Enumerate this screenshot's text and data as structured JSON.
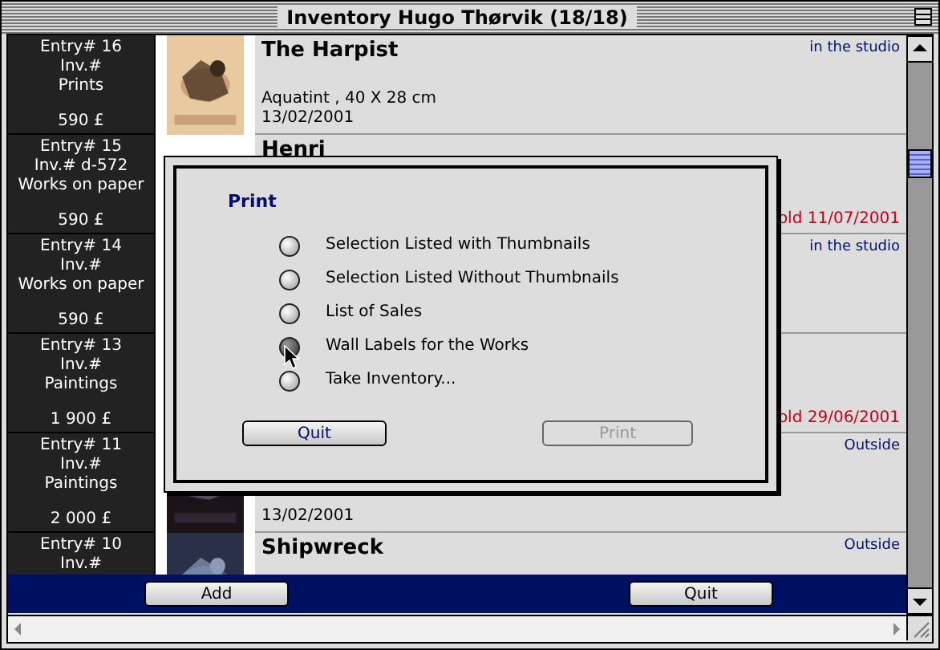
{
  "window": {
    "title": "Inventory Hugo Thørvik (18/18)"
  },
  "rows": [
    {
      "entry": "Entry# 16",
      "inv": "Inv.#",
      "category": "Prints",
      "price": "590 £",
      "title": "The Harpist",
      "details": "Aquatint , 40 X 28 cm",
      "date": "13/02/2001",
      "status": {
        "kind": "place",
        "text": "in the studio"
      }
    },
    {
      "entry": "Entry# 15",
      "inv": "Inv.# d-572",
      "category": "Works on paper",
      "price": "590 £",
      "title": "Henri",
      "status": {
        "kind": "sold",
        "text": "old 11/07/2001"
      }
    },
    {
      "entry": "Entry# 14",
      "inv": "Inv.#",
      "category": "Works on paper",
      "price": "590 £",
      "status": {
        "kind": "place",
        "text": "in the studio"
      }
    },
    {
      "entry": "Entry# 13",
      "inv": "Inv.#",
      "category": "Paintings",
      "price": "1 900 £",
      "status": {
        "kind": "sold",
        "text": "old 29/06/2001"
      }
    },
    {
      "entry": "Entry# 11",
      "inv": "Inv.#",
      "category": "Paintings",
      "price": "2 000 £",
      "date": "13/02/2001",
      "status": {
        "kind": "place",
        "text": "Outside"
      }
    },
    {
      "entry": "Entry# 10",
      "inv": "Inv.#",
      "title": "Shipwreck",
      "status": {
        "kind": "place",
        "text": "Outside"
      }
    }
  ],
  "bottom_buttons": [
    {
      "label": "Add"
    },
    {
      "label": "Quit"
    }
  ],
  "dialog": {
    "title": "Print",
    "options": [
      {
        "label": "Selection Listed with Thumbnails",
        "selected": false
      },
      {
        "label": "Selection Listed Without Thumbnails",
        "selected": false
      },
      {
        "label": "List of Sales",
        "selected": false
      },
      {
        "label": "Wall Labels for the Works",
        "selected": true
      },
      {
        "label": "Take Inventory...",
        "selected": false
      }
    ],
    "buttons": [
      {
        "label": "Quit",
        "disabled": false
      },
      {
        "label": "Print",
        "disabled": true
      }
    ]
  }
}
